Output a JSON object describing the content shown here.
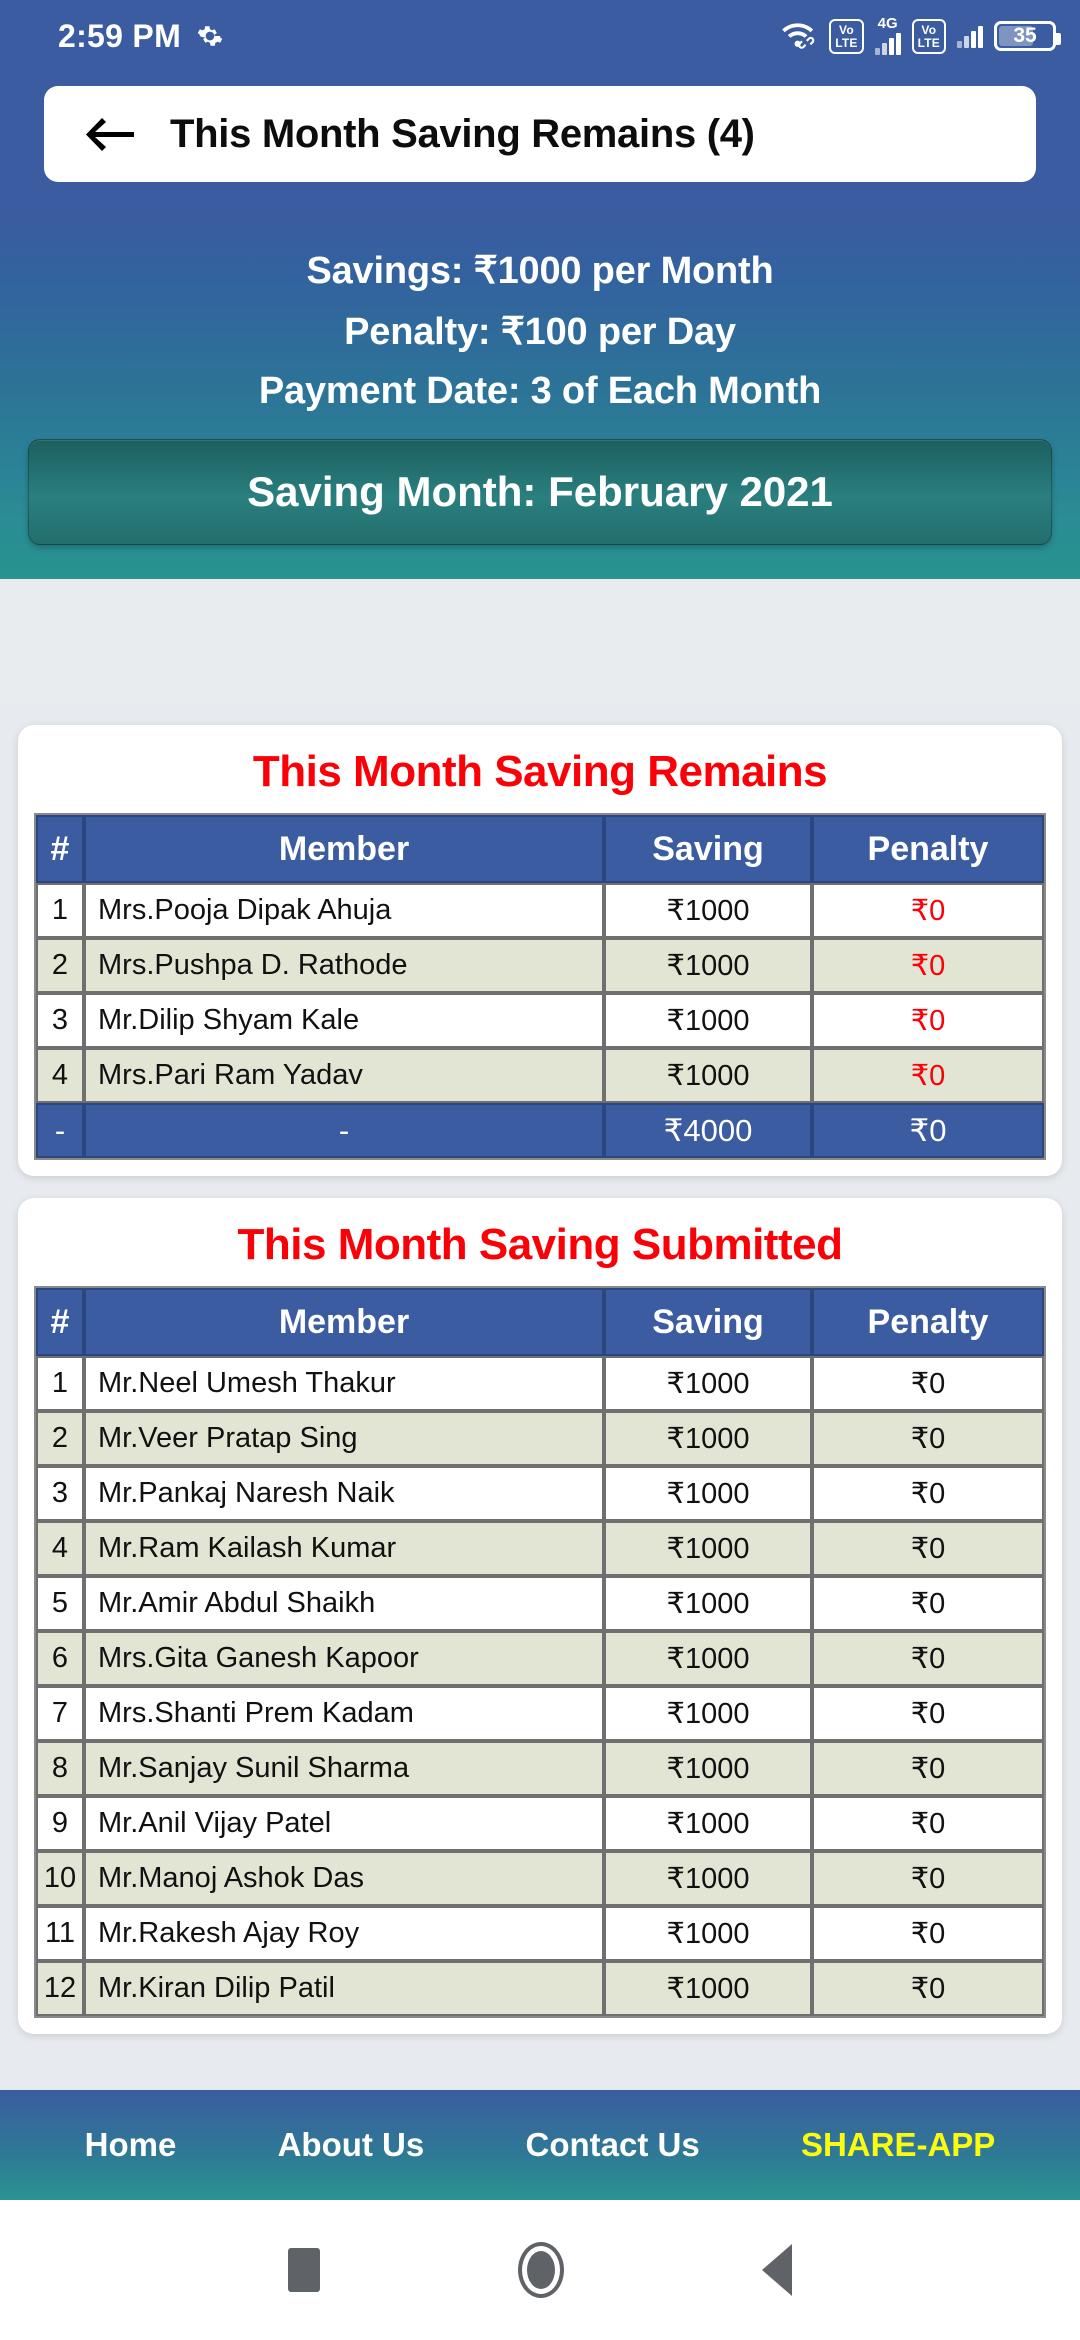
{
  "status_bar": {
    "time": "2:59 PM",
    "gear_icon": "gear-icon",
    "wifi_icon": "wifi-link-icon",
    "volte1": {
      "top": "Vo",
      "bottom": "LTE"
    },
    "network_label": "4G",
    "volte2": {
      "top": "Vo",
      "bottom": "LTE"
    },
    "battery_level": "35"
  },
  "appbar": {
    "back_icon": "back-arrow-icon",
    "title": "This Month Saving Remains (4)"
  },
  "hero": {
    "savings_line": "Savings: ₹1000 per Month",
    "penalty_line": "Penalty: ₹100 per Day",
    "payment_date_line": "Payment Date: 3 of Each Month",
    "month_banner": "Saving Month: February 2021"
  },
  "colors": {
    "header_blue": "#3b5ca0",
    "teal": "#2a9490",
    "title_red": "#fb0007",
    "share_yellow": "#fbfb10",
    "row_alt": "#e3e5d4"
  },
  "table_remains": {
    "title": "This Month Saving Remains",
    "columns": [
      "#",
      "Member",
      "Saving",
      "Penalty"
    ],
    "rows": [
      {
        "idx": "1",
        "member": "Mrs.Pooja Dipak Ahuja",
        "saving": "₹1000",
        "penalty": "₹0"
      },
      {
        "idx": "2",
        "member": "Mrs.Pushpa D. Rathode",
        "saving": "₹1000",
        "penalty": "₹0"
      },
      {
        "idx": "3",
        "member": "Mr.Dilip Shyam Kale",
        "saving": "₹1000",
        "penalty": "₹0"
      },
      {
        "idx": "4",
        "member": "Mrs.Pari Ram Yadav",
        "saving": "₹1000",
        "penalty": "₹0"
      }
    ],
    "total": {
      "idx": "-",
      "member": "-",
      "saving": "₹4000",
      "penalty": "₹0"
    }
  },
  "table_submitted": {
    "title": "This Month Saving Submitted",
    "columns": [
      "#",
      "Member",
      "Saving",
      "Penalty"
    ],
    "rows": [
      {
        "idx": "1",
        "member": "Mr.Neel Umesh Thakur",
        "saving": "₹1000",
        "penalty": "₹0"
      },
      {
        "idx": "2",
        "member": "Mr.Veer Pratap Sing",
        "saving": "₹1000",
        "penalty": "₹0"
      },
      {
        "idx": "3",
        "member": "Mr.Pankaj Naresh Naik",
        "saving": "₹1000",
        "penalty": "₹0"
      },
      {
        "idx": "4",
        "member": "Mr.Ram Kailash Kumar",
        "saving": "₹1000",
        "penalty": "₹0"
      },
      {
        "idx": "5",
        "member": "Mr.Amir Abdul Shaikh",
        "saving": "₹1000",
        "penalty": "₹0"
      },
      {
        "idx": "6",
        "member": "Mrs.Gita Ganesh Kapoor",
        "saving": "₹1000",
        "penalty": "₹0"
      },
      {
        "idx": "7",
        "member": "Mrs.Shanti Prem Kadam",
        "saving": "₹1000",
        "penalty": "₹0"
      },
      {
        "idx": "8",
        "member": "Mr.Sanjay Sunil Sharma",
        "saving": "₹1000",
        "penalty": "₹0"
      },
      {
        "idx": "9",
        "member": "Mr.Anil Vijay Patel",
        "saving": "₹1000",
        "penalty": "₹0"
      },
      {
        "idx": "10",
        "member": "Mr.Manoj Ashok Das",
        "saving": "₹1000",
        "penalty": "₹0"
      },
      {
        "idx": "11",
        "member": "Mr.Rakesh Ajay Roy",
        "saving": "₹1000",
        "penalty": "₹0"
      },
      {
        "idx": "12",
        "member": "Mr.Kiran Dilip Patil",
        "saving": "₹1000",
        "penalty": "₹0"
      }
    ]
  },
  "bottom_nav": {
    "items": [
      {
        "label": "Home"
      },
      {
        "label": "About Us"
      },
      {
        "label": "Contact Us"
      },
      {
        "label": "SHARE-APP"
      }
    ]
  },
  "android_nav": {
    "recent_icon": "recent-apps-icon",
    "home_icon": "home-circle-icon",
    "back_icon": "back-triangle-icon"
  }
}
